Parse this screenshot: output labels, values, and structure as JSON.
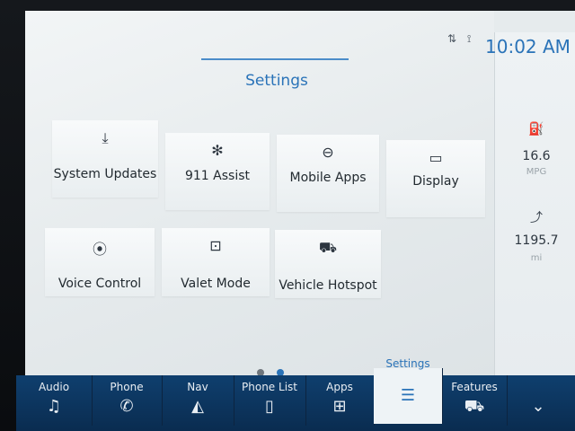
{
  "status": {
    "icons": "⇅ ⟟",
    "time": "10:02 AM"
  },
  "header": {
    "title": "Settings"
  },
  "tiles": [
    {
      "label": "System Updates",
      "icon": "⤓",
      "icon_name": "download-icon"
    },
    {
      "label": "911 Assist",
      "icon": "✻",
      "icon_name": "assist-icon"
    },
    {
      "label": "Mobile Apps",
      "icon": "⊖",
      "icon_name": "link-icon"
    },
    {
      "label": "Display",
      "icon": "▭",
      "icon_name": "display-icon"
    },
    {
      "label": "Voice Control",
      "icon": "⦿",
      "icon_name": "voice-icon"
    },
    {
      "label": "Valet Mode",
      "icon": "⊡",
      "icon_name": "lock-icon"
    },
    {
      "label": "Vehicle Hotspot",
      "icon": "⛟",
      "icon_name": "hotspot-icon"
    }
  ],
  "pagination": {
    "pages": 2,
    "active": 2
  },
  "side": {
    "mpg_value": "16.6",
    "mpg_unit": "MPG",
    "mpg_icon": "⛽",
    "range_value": "1195.7",
    "range_unit": "mi",
    "range_icon": "⤴"
  },
  "navbar": [
    {
      "label": "Audio",
      "icon": "♫"
    },
    {
      "label": "Phone",
      "icon": "✆"
    },
    {
      "label": "Nav",
      "icon": "◭"
    },
    {
      "label": "Phone List",
      "icon": "▯"
    },
    {
      "label": "Apps",
      "icon": "⊞"
    },
    {
      "label": "Settings",
      "icon": "☰",
      "active": true
    },
    {
      "label": "Features",
      "icon": "⛟"
    },
    {
      "label": "",
      "icon": "⌄"
    }
  ],
  "colors": {
    "accent": "#2a73b8",
    "navbar": "#0f3f6e"
  }
}
